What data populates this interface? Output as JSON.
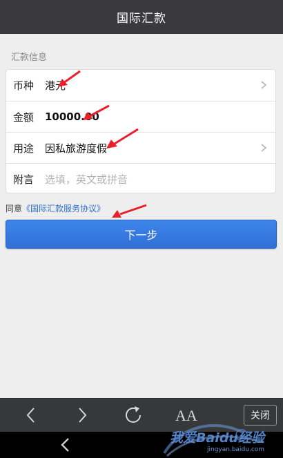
{
  "header": {
    "title": "国际汇款"
  },
  "section": {
    "label": "汇款信息"
  },
  "form": {
    "currency": {
      "label": "币种",
      "value": "港元"
    },
    "amount": {
      "label": "金额",
      "value": "10000.00"
    },
    "purpose": {
      "label": "用途",
      "value": "因私旅游度假"
    },
    "note": {
      "label": "附言",
      "placeholder": "选填，英文或拼音"
    }
  },
  "agreement": {
    "prefix": "同意",
    "link": "《国际汇款服务协议》"
  },
  "next_button": {
    "label": "下一步"
  },
  "browser_toolbar": {
    "font_size_label": "AA",
    "close_label": "关闭"
  },
  "watermark": {
    "text": "我爱Baidu经验",
    "sub": "jingyan.baidu.com"
  },
  "colors": {
    "header_bg": "#3a3a3c",
    "accent_button": "#3b82e6",
    "link": "#2f6fc9",
    "annotation_arrow": "#e8202a"
  }
}
